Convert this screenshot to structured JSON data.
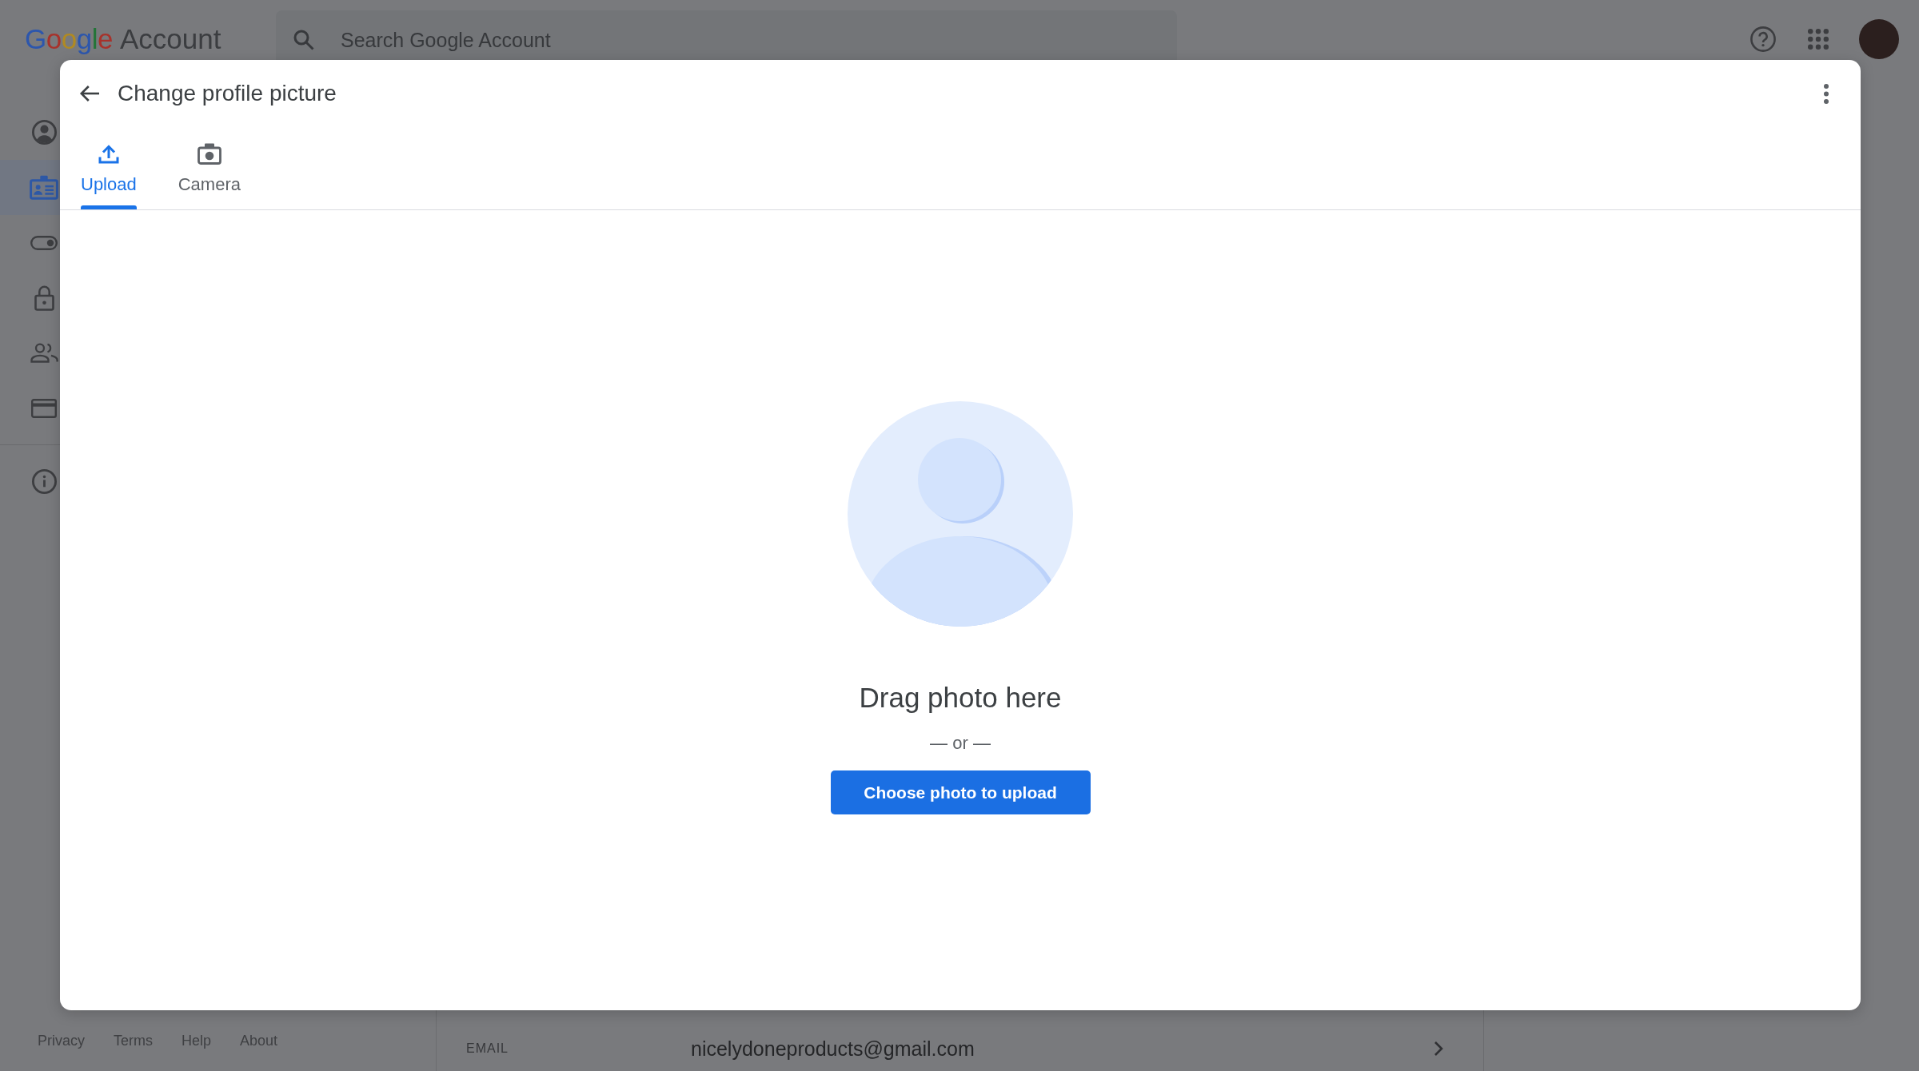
{
  "header": {
    "logo": {
      "brand": "Google",
      "product": "Account"
    },
    "search": {
      "placeholder": "Search Google Account"
    }
  },
  "sidebar": {
    "groups": [
      {
        "items": [
          {
            "selected": false
          },
          {
            "selected": true
          },
          {
            "selected": false
          },
          {
            "selected": false
          },
          {
            "selected": false
          },
          {
            "selected": false
          }
        ]
      },
      {
        "items": [
          {
            "selected": false
          }
        ]
      }
    ],
    "footer_links": [
      "Privacy",
      "Terms",
      "Help",
      "About"
    ]
  },
  "main": {
    "rows": [
      {
        "label": "EMAIL",
        "value": "nicelydoneproducts@gmail.com"
      }
    ]
  },
  "dialog": {
    "title": "Change profile picture",
    "tabs": [
      {
        "label": "Upload",
        "selected": true
      },
      {
        "label": "Camera",
        "selected": false
      }
    ],
    "upload": {
      "heading": "Drag photo here",
      "separator": "— or —",
      "button": "Choose photo to upload"
    }
  }
}
